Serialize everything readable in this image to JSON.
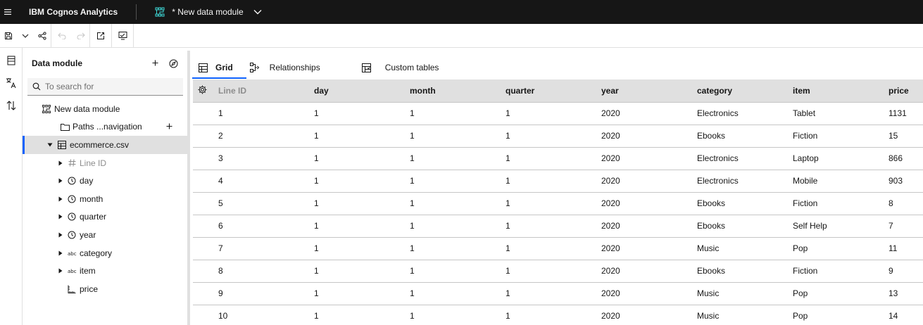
{
  "header": {
    "menu_icon": "hamburger-icon",
    "app_title": "IBM Cognos Analytics",
    "module_icon": "data-module-icon",
    "module_title": "* New data module",
    "module_dropdown_icon": "chevron-down-icon"
  },
  "toolbar": {
    "buttons": [
      {
        "name": "save-icon"
      },
      {
        "name": "chevron-down-icon"
      },
      {
        "name": "share-icon"
      },
      {
        "name": "undo-icon",
        "disabled": true
      },
      {
        "name": "redo-icon",
        "disabled": true
      },
      {
        "name": "launch-icon"
      },
      {
        "name": "validate-icon"
      }
    ]
  },
  "left_rail": {
    "buttons": [
      {
        "name": "data-module-panel-icon"
      },
      {
        "name": "translate-icon"
      },
      {
        "name": "sort-icon"
      }
    ]
  },
  "panel": {
    "title": "Data module",
    "add_icon": "add-icon",
    "compass_icon": "compass-icon",
    "search": {
      "placeholder": "To search for",
      "value": ""
    },
    "tree": [
      {
        "label": "New data module",
        "icon": "data-module-icon",
        "level": 0,
        "caret": "none"
      },
      {
        "label": "Paths ...navigation",
        "icon": "folder-icon",
        "level": 1,
        "caret": "none",
        "has_add": true
      },
      {
        "label": "ecommerce.csv",
        "icon": "table-icon",
        "level": 1,
        "caret": "down",
        "selected": true
      },
      {
        "label": "Line ID",
        "icon": "hash-icon",
        "level": 2,
        "caret": "right",
        "muted": true
      },
      {
        "label": "day",
        "icon": "clock-icon",
        "level": 2,
        "caret": "right"
      },
      {
        "label": "month",
        "icon": "clock-icon",
        "level": 2,
        "caret": "right"
      },
      {
        "label": "quarter",
        "icon": "clock-icon",
        "level": 2,
        "caret": "right"
      },
      {
        "label": "year",
        "icon": "clock-icon",
        "level": 2,
        "caret": "right"
      },
      {
        "label": "category",
        "icon": "text-abc-icon",
        "level": 2,
        "caret": "right"
      },
      {
        "label": "item",
        "icon": "text-abc-icon",
        "level": 2,
        "caret": "right"
      },
      {
        "label": "price",
        "icon": "measure-icon",
        "level": 2,
        "caret": "none"
      }
    ]
  },
  "main": {
    "tabs": [
      {
        "label": "Grid",
        "icon": "grid-icon",
        "active": true
      },
      {
        "label": "Relationships",
        "icon": "relationships-icon",
        "active": false
      },
      {
        "label": "Custom tables",
        "icon": "custom-table-icon",
        "active": false
      }
    ],
    "grid": {
      "settings_icon": "gear-icon",
      "columns": [
        "Line ID",
        "day",
        "month",
        "quarter",
        "year",
        "category",
        "item",
        "price"
      ],
      "rows": [
        [
          "1",
          "1",
          "1",
          "1",
          "2020",
          "Electronics",
          "Tablet",
          "1131"
        ],
        [
          "2",
          "1",
          "1",
          "1",
          "2020",
          "Ebooks",
          "Fiction",
          "15"
        ],
        [
          "3",
          "1",
          "1",
          "1",
          "2020",
          "Electronics",
          "Laptop",
          "866"
        ],
        [
          "4",
          "1",
          "1",
          "1",
          "2020",
          "Electronics",
          "Mobile",
          "903"
        ],
        [
          "5",
          "1",
          "1",
          "1",
          "2020",
          "Ebooks",
          "Fiction",
          "8"
        ],
        [
          "6",
          "1",
          "1",
          "1",
          "2020",
          "Ebooks",
          "Self Help",
          "7"
        ],
        [
          "7",
          "1",
          "1",
          "1",
          "2020",
          "Music",
          "Pop",
          "11"
        ],
        [
          "8",
          "1",
          "1",
          "1",
          "2020",
          "Ebooks",
          "Fiction",
          "9"
        ],
        [
          "9",
          "1",
          "1",
          "1",
          "2020",
          "Music",
          "Pop",
          "13"
        ],
        [
          "10",
          "1",
          "1",
          "1",
          "2020",
          "Music",
          "Pop",
          "14"
        ]
      ]
    }
  },
  "colors": {
    "header_bg": "#161616",
    "accent": "#0f62fe",
    "module_icon": "#3ddbd9",
    "grid_header_bg": "#e0e0e0",
    "selected_row_bg": "#e0e0e0"
  }
}
